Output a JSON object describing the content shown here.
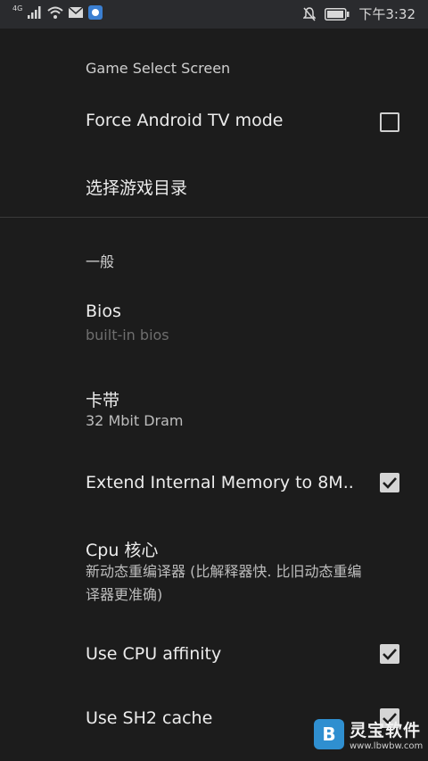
{
  "status_bar": {
    "network": "4G",
    "time": "下午3:32"
  },
  "sections": {
    "game_select": {
      "header": "Game Select Screen",
      "force_tv": {
        "title": "Force Android TV mode",
        "checked": false
      },
      "game_dir": {
        "title": "选择游戏目录"
      }
    },
    "general": {
      "header": "一般",
      "bios": {
        "title": "Bios",
        "summary": "built-in bios"
      },
      "cart": {
        "title": "卡带",
        "summary": "32 Mbit Dram"
      },
      "extend_memory": {
        "title": "Extend Internal Memory to 8M..",
        "checked": true
      },
      "cpu_core": {
        "title": "Cpu 核心",
        "summary_line1": "新动态重编译器 (比解释器快. 比旧动态重编",
        "summary_line2": "译器更准确)"
      },
      "cpu_affinity": {
        "title": "Use CPU affinity",
        "checked": true
      },
      "sh2_cache": {
        "title": "Use SH2 cache",
        "checked": true
      }
    }
  },
  "watermark": {
    "logo_letter": "B",
    "name": "灵宝软件",
    "url": "www.lbwbw.com"
  },
  "colors": {
    "background": "#1c1c1c",
    "status_bar": "#2a2b2e",
    "checkbox": "#d5d5d5",
    "watermark_logo": "#2f8fd0"
  }
}
